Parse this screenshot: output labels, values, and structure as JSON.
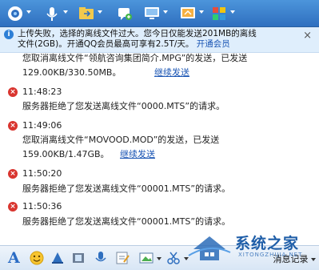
{
  "notice": {
    "line1": "上传失败，选择的离线文件过大。您今日仅能发送201MB的离线",
    "line2_a": "文件(2GB)。开通QQ会员最高可享有2.5T/天。",
    "link": "开通会员",
    "close": "×",
    "icon": "info-icon"
  },
  "messages": [
    {
      "type": "text",
      "text": "您取消离线文件“领航咨询集团简介.MPG”的发送，已发送"
    },
    {
      "type": "progress",
      "size": "129.00KB/330.50MB。",
      "link": "继续发送"
    },
    {
      "type": "time",
      "time": "11:48:23"
    },
    {
      "type": "text",
      "text": "服务器拒绝了您发送离线文件“0000.MTS”的请求。"
    },
    {
      "type": "time",
      "time": "11:49:06"
    },
    {
      "type": "text",
      "text": "您取消离线文件“MOVOOD.MOD”的发送，已发送"
    },
    {
      "type": "progress",
      "size": "159.00KB/1.47GB。",
      "link": "继续发送"
    },
    {
      "type": "time",
      "time": "11:50:20"
    },
    {
      "type": "text",
      "text": "服务器拒绝了您发送离线文件“00001.MTS”的请求。"
    },
    {
      "type": "time",
      "time": "11:50:36"
    },
    {
      "type": "text",
      "text": "服务器拒绝了您发送离线文件“00001.MTS”的请求。"
    }
  ],
  "bottom": {
    "history": "消息记录",
    "watermark_cn": "系统之家",
    "watermark_en": "XITONGZHIJIA.NET"
  },
  "colors": {
    "toolbar": "#3a80cf",
    "error": "#d9352f",
    "link": "#1a55b4"
  }
}
